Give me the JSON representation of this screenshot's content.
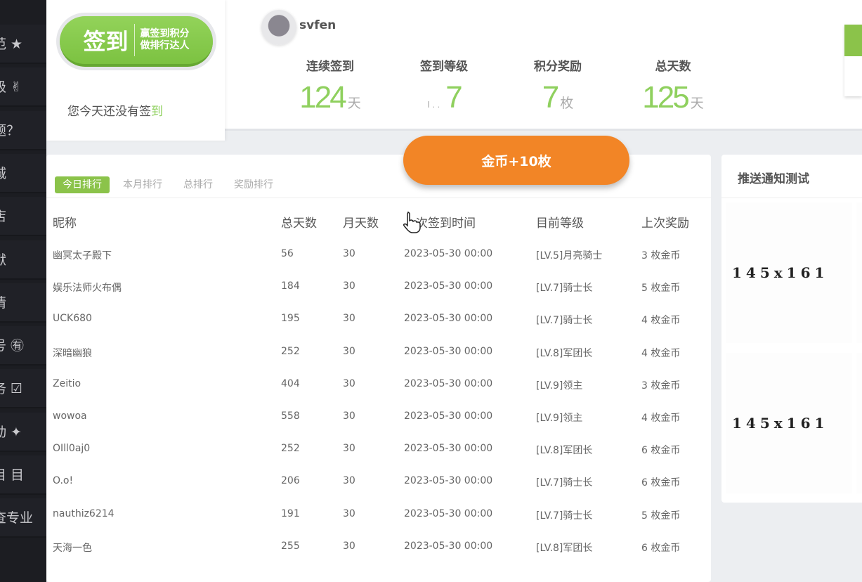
{
  "sidebar": {
    "items": [
      "范 ★",
      "级 ✌",
      "题？",
      "城",
      "店",
      "献",
      "情",
      "号 ㊒",
      "务 ☑",
      "动 ✦",
      "目 目",
      "查专业"
    ]
  },
  "sign": {
    "button_main": "签到",
    "button_sub1": "赢签到积分",
    "button_sub2": "做排行达人",
    "hint_prefix": "您今天还没有签",
    "hint_suffix": "到"
  },
  "user": {
    "name": "svfen"
  },
  "stats": [
    {
      "label": "连续签到",
      "value": "124",
      "unit": "天"
    },
    {
      "label": "签到等级",
      "value": "7",
      "prefix": "I . .",
      "unit": ""
    },
    {
      "label": "积分奖励",
      "value": "7",
      "unit": "枚"
    },
    {
      "label": "总天数",
      "value": "125",
      "unit": "天"
    }
  ],
  "coin_popup": "金币+10枚",
  "ranking": {
    "tabs": [
      "今日排行",
      "本月排行",
      "总排行",
      "奖励排行"
    ],
    "headers": [
      "昵称",
      "总天数",
      "月天数",
      "上次签到时间",
      "目前等级",
      "上次奖励"
    ],
    "rows": [
      [
        "幽冥太子殿下",
        "56",
        "30",
        "2023-05-30 00:00",
        "[LV.5]月亮骑士",
        "3 枚金币"
      ],
      [
        "娱乐法师火布偶",
        "184",
        "30",
        "2023-05-30 00:00",
        "[LV.7]骑士长",
        "5 枚金币"
      ],
      [
        "UCK680",
        "195",
        "30",
        "2023-05-30 00:00",
        "[LV.7]骑士长",
        "4 枚金币"
      ],
      [
        "深暗幽狼",
        "252",
        "30",
        "2023-05-30 00:00",
        "[LV.8]军团长",
        "4 枚金币"
      ],
      [
        "Zeitio",
        "404",
        "30",
        "2023-05-30 00:00",
        "[LV.9]领主",
        "3 枚金币"
      ],
      [
        "wowoa",
        "558",
        "30",
        "2023-05-30 00:00",
        "[LV.9]领主",
        "4 枚金币"
      ],
      [
        "OIll0aj0",
        "252",
        "30",
        "2023-05-30 00:00",
        "[LV.8]军团长",
        "6 枚金币"
      ],
      [
        "O.o!",
        "206",
        "30",
        "2023-05-30 00:00",
        "[LV.7]骑士长",
        "6 枚金币"
      ],
      [
        "nauthiz6214",
        "191",
        "30",
        "2023-05-30 00:00",
        "[LV.7]骑士长",
        "5 枚金币"
      ],
      [
        "天海一色",
        "255",
        "30",
        "2023-05-30 00:00",
        "[LV.8]军团长",
        "6 枚金币"
      ]
    ]
  },
  "push": {
    "title": "推送通知测试",
    "placeholders": [
      "145x161",
      "145x161"
    ]
  }
}
